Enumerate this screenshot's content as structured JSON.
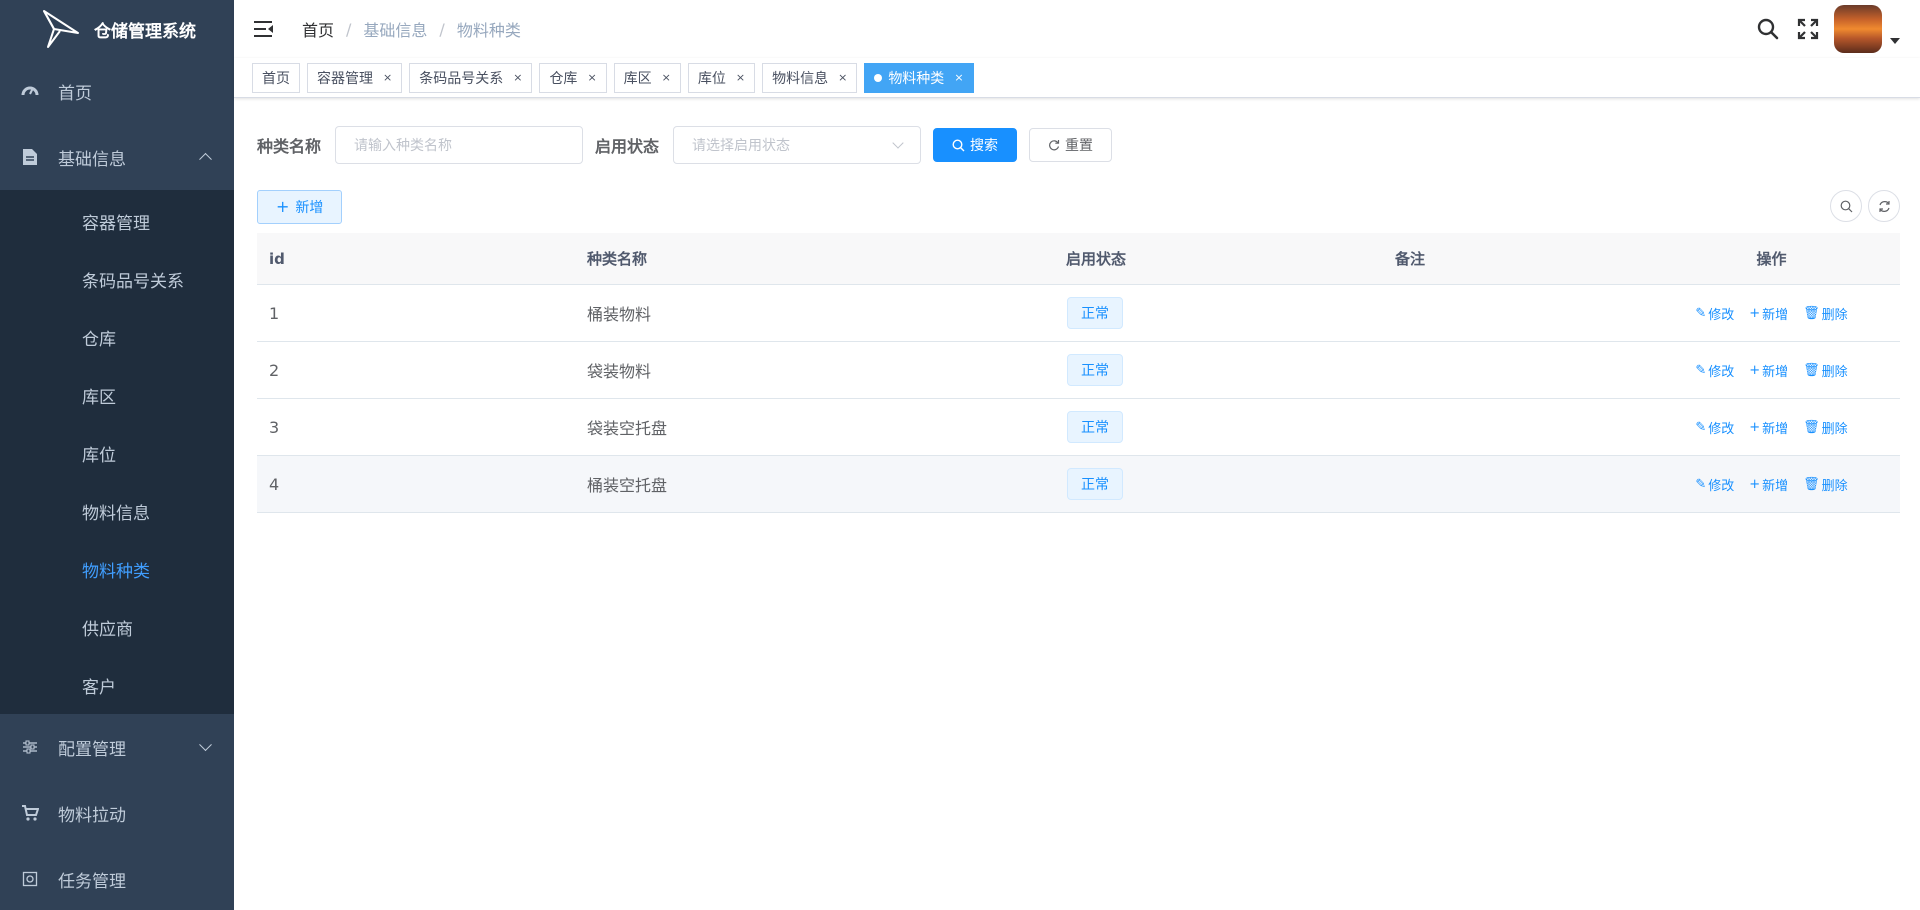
{
  "app": {
    "title": "仓储管理系统"
  },
  "sidebar": {
    "items": [
      {
        "label": "首页",
        "icon": "dashboard-icon"
      },
      {
        "label": "基础信息",
        "icon": "document-icon",
        "expanded": true,
        "children": [
          "容器管理",
          "条码品号关系",
          "仓库",
          "库区",
          "库位",
          "物料信息",
          "物料种类",
          "供应商",
          "客户"
        ],
        "active_child": "物料种类"
      },
      {
        "label": "配置管理",
        "icon": "sliders-icon",
        "expanded": false
      },
      {
        "label": "物料拉动",
        "icon": "cart-icon"
      },
      {
        "label": "任务管理",
        "icon": "task-icon"
      }
    ]
  },
  "header": {
    "breadcrumb": [
      "首页",
      "基础信息",
      "物料种类"
    ]
  },
  "tags": [
    {
      "label": "首页",
      "closable": false
    },
    {
      "label": "容器管理",
      "closable": true
    },
    {
      "label": "条码品号关系",
      "closable": true
    },
    {
      "label": "仓库",
      "closable": true
    },
    {
      "label": "库区",
      "closable": true
    },
    {
      "label": "库位",
      "closable": true
    },
    {
      "label": "物料信息",
      "closable": true
    },
    {
      "label": "物料种类",
      "closable": true,
      "active": true
    }
  ],
  "search": {
    "name_label": "种类名称",
    "name_placeholder": "请输入种类名称",
    "status_label": "启用状态",
    "status_placeholder": "请选择启用状态",
    "search_btn": "搜索",
    "reset_btn": "重置"
  },
  "toolbar": {
    "add_btn": "新增"
  },
  "table": {
    "columns": [
      "id",
      "种类名称",
      "启用状态",
      "备注",
      "操作"
    ],
    "rows": [
      {
        "id": "1",
        "name": "桶装物料",
        "status": "正常",
        "remark": ""
      },
      {
        "id": "2",
        "name": "袋装物料",
        "status": "正常",
        "remark": ""
      },
      {
        "id": "3",
        "name": "袋装空托盘",
        "status": "正常",
        "remark": ""
      },
      {
        "id": "4",
        "name": "桶装空托盘",
        "status": "正常",
        "remark": ""
      }
    ],
    "ops": {
      "edit": "修改",
      "add": "新增",
      "delete": "删除"
    }
  },
  "colors": {
    "sidebar_bg": "#304156",
    "submenu_bg": "#1f2d3d",
    "primary": "#1890ff",
    "active_tag": "#42a5f5"
  }
}
